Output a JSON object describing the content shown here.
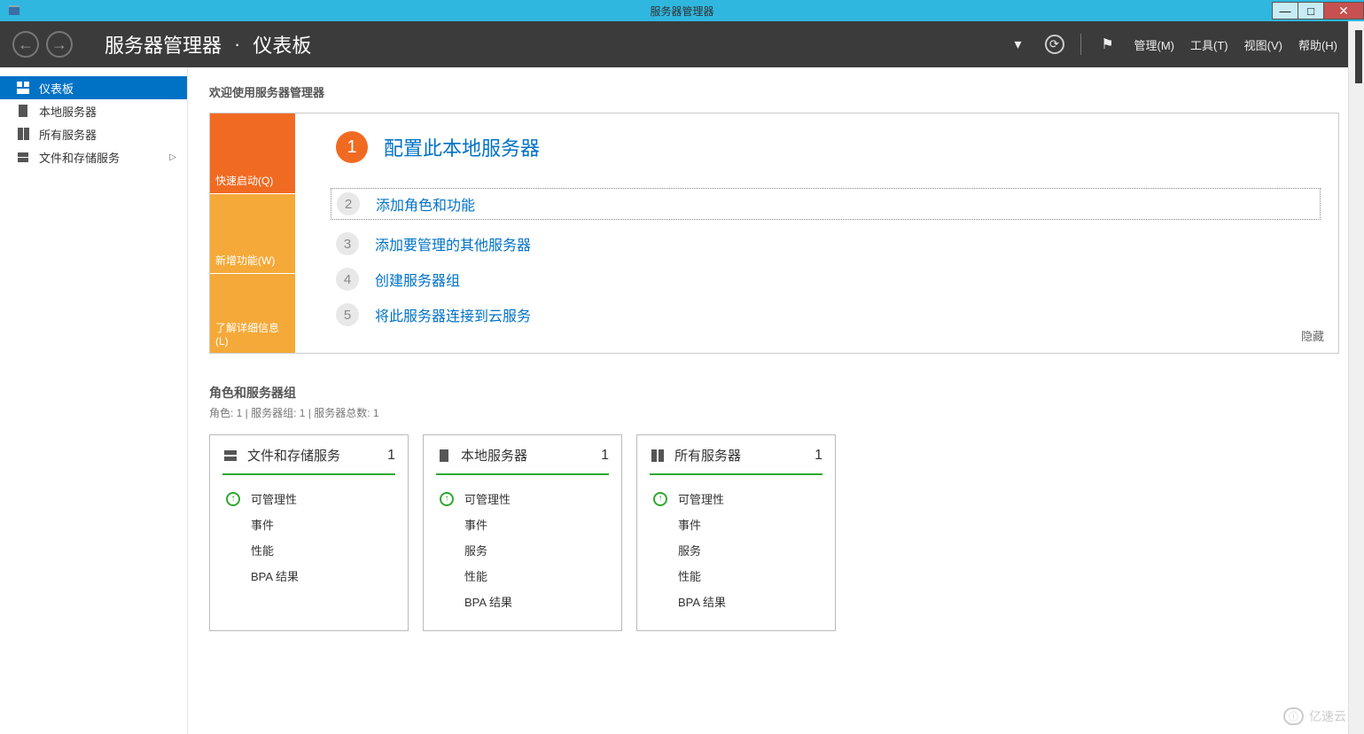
{
  "title": "服务器管理器",
  "breadcrumb": {
    "app": "服务器管理器",
    "sep": "·",
    "page": "仪表板"
  },
  "menus": {
    "manage": "管理(M)",
    "tools": "工具(T)",
    "view": "视图(V)",
    "help": "帮助(H)"
  },
  "sidebar": {
    "items": [
      {
        "label": "仪表板"
      },
      {
        "label": "本地服务器"
      },
      {
        "label": "所有服务器"
      },
      {
        "label": "文件和存储服务"
      }
    ]
  },
  "welcome": {
    "header": "欢迎使用服务器管理器",
    "tabs": {
      "quick": "快速启动(Q)",
      "new": "新增功能(W)",
      "learn": "了解详细信息(L)"
    },
    "steps": [
      {
        "num": "1",
        "label": "配置此本地服务器"
      },
      {
        "num": "2",
        "label": "添加角色和功能"
      },
      {
        "num": "3",
        "label": "添加要管理的其他服务器"
      },
      {
        "num": "4",
        "label": "创建服务器组"
      },
      {
        "num": "5",
        "label": "将此服务器连接到云服务"
      }
    ],
    "hide": "隐藏"
  },
  "roles": {
    "title": "角色和服务器组",
    "sub": "角色: 1 | 服务器组: 1 | 服务器总数: 1",
    "tiles": [
      {
        "title": "文件和存储服务",
        "count": "1",
        "rows": [
          "可管理性",
          "事件",
          "性能",
          "BPA 结果"
        ]
      },
      {
        "title": "本地服务器",
        "count": "1",
        "rows": [
          "可管理性",
          "事件",
          "服务",
          "性能",
          "BPA 结果"
        ]
      },
      {
        "title": "所有服务器",
        "count": "1",
        "rows": [
          "可管理性",
          "事件",
          "服务",
          "性能",
          "BPA 结果"
        ]
      }
    ]
  },
  "watermark": "亿速云"
}
